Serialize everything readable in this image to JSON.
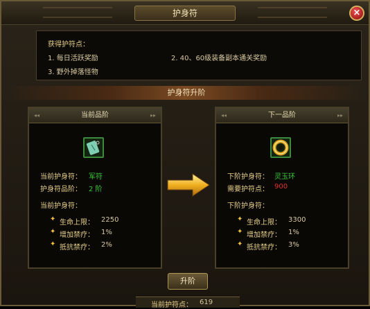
{
  "window": {
    "title": "护身符"
  },
  "info": {
    "header": "获得护符点：",
    "row1a": "1. 每日活跃奖励",
    "row1b": "2. 40、60级装备副本通关奖励",
    "row2": "3. 野外掉落怪物"
  },
  "section_title": "护身符升阶",
  "current": {
    "header": "当前品阶",
    "item_icon": "amulet-jade-tablet-icon",
    "name_label": "当前护身符：",
    "name_value": "军符",
    "grade_label": "护身符品阶：",
    "grade_value": "2 阶",
    "stats_header": "当前护身符：",
    "stats": [
      {
        "label": "生命上限：",
        "value": "2250"
      },
      {
        "label": "增加禁疗：",
        "value": "1%"
      },
      {
        "label": "抵抗禁疗：",
        "value": "2%"
      }
    ]
  },
  "next": {
    "header": "下一品阶",
    "item_icon": "amulet-jade-ring-icon",
    "name_label": "下阶护身符：",
    "name_value": "灵玉环",
    "need_label": "需要护符点：",
    "need_value": "900",
    "stats_header": "下阶护身符：",
    "stats": [
      {
        "label": "生命上限：",
        "value": "3300"
      },
      {
        "label": "增加禁疗：",
        "value": "1%"
      },
      {
        "label": "抵抗禁疗：",
        "value": "3%"
      }
    ]
  },
  "upgrade_button": "升阶",
  "points": {
    "label": "当前护符点：",
    "value": "619"
  },
  "colors": {
    "green": "#38c838",
    "red": "#e03030",
    "gold": "#e6d08a"
  }
}
